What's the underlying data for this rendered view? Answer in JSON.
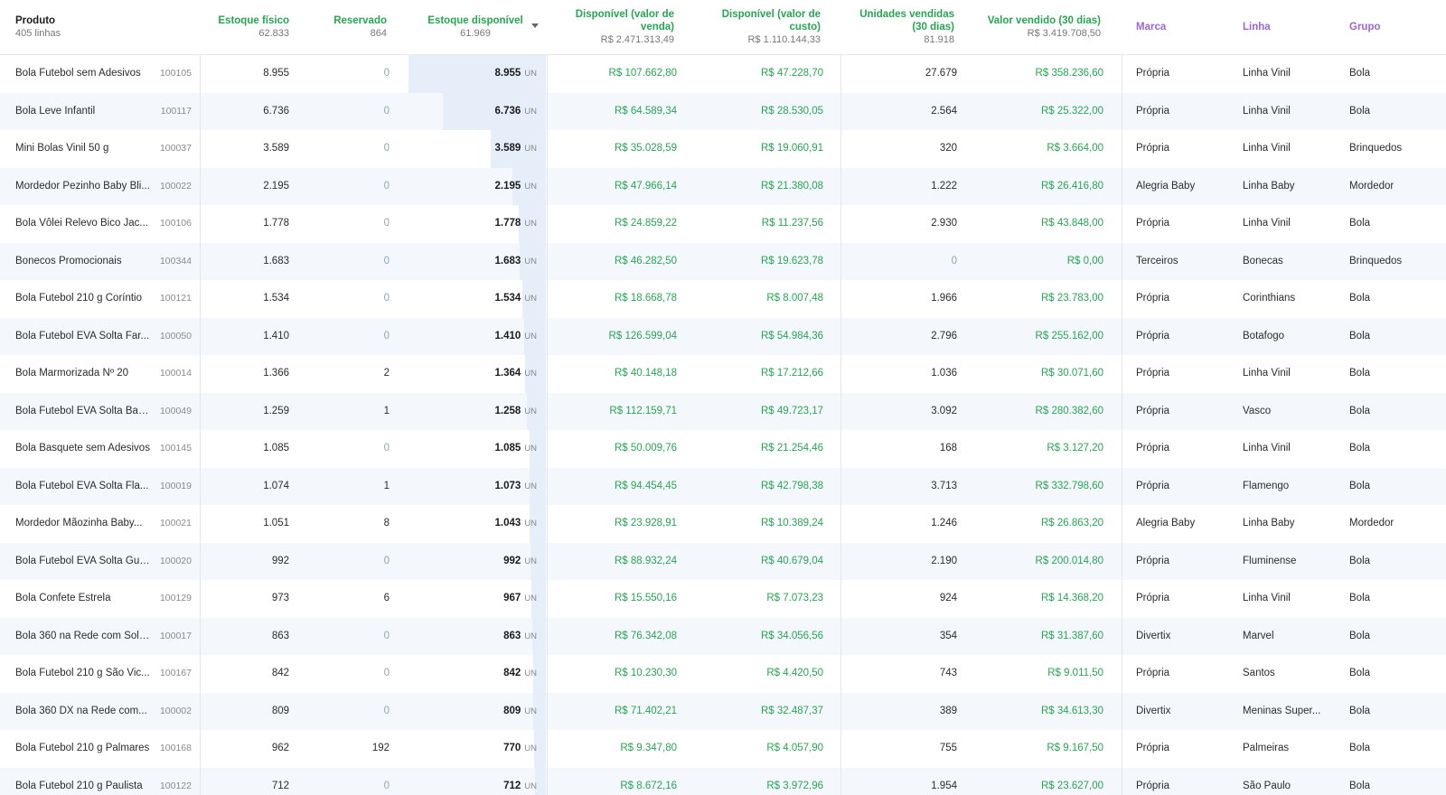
{
  "header": {
    "produto": "Produto",
    "produto_sub": "405 linhas",
    "estoque_fisico": "Estoque físico",
    "estoque_fisico_total": "62.833",
    "reservado": "Reservado",
    "reservado_total": "864",
    "estoque_disponivel": "Estoque disponível",
    "estoque_disponivel_total": "61.969",
    "disp_venda_l1": "Disponível (valor de",
    "disp_venda_l2": "venda)",
    "disp_venda_total": "R$ 2.471.313,49",
    "disp_custo_l1": "Disponível (valor de",
    "disp_custo_l2": "custo)",
    "disp_custo_total": "R$ 1.110.144,33",
    "unid_l1": "Unidades vendidas",
    "unid_l2": "(30 dias)",
    "unid_total": "81.918",
    "valor_vendido": "Valor vendido (30 dias)",
    "valor_vendido_total": "R$ 3.419.708,50",
    "marca": "Marca",
    "linha": "Linha",
    "grupo": "Grupo"
  },
  "unit_label": "UN",
  "stock_scale_max": 8955,
  "colors": {
    "green": "#27a552",
    "purple": "#9b66d9",
    "zero": "#8fa6b8",
    "bar": "#e6eefa"
  },
  "rows": [
    {
      "produto": "Bola Futebol sem Adesivos",
      "codigo": "100105",
      "fisico": "8.955",
      "reservado": "0",
      "disponivel": "8.955",
      "venda": "R$ 107.662,80",
      "custo": "R$ 47.228,70",
      "unidades": "27.679",
      "valor": "R$ 358.236,60",
      "marca": "Própria",
      "linha": "Linha Vinil",
      "grupo": "Bola"
    },
    {
      "produto": "Bola Leve Infantil",
      "codigo": "100117",
      "fisico": "6.736",
      "reservado": "0",
      "disponivel": "6.736",
      "venda": "R$ 64.589,34",
      "custo": "R$ 28.530,05",
      "unidades": "2.564",
      "valor": "R$ 25.322,00",
      "marca": "Própria",
      "linha": "Linha Vinil",
      "grupo": "Bola"
    },
    {
      "produto": "Mini Bolas Vinil 50 g",
      "codigo": "100037",
      "fisico": "3.589",
      "reservado": "0",
      "disponivel": "3.589",
      "venda": "R$ 35.028,59",
      "custo": "R$ 19.060,91",
      "unidades": "320",
      "valor": "R$ 3.664,00",
      "marca": "Própria",
      "linha": "Linha Vinil",
      "grupo": "Brinquedos"
    },
    {
      "produto": "Mordedor Pezinho Baby Bli...",
      "codigo": "100022",
      "fisico": "2.195",
      "reservado": "0",
      "disponivel": "2.195",
      "venda": "R$ 47.966,14",
      "custo": "R$ 21.380,08",
      "unidades": "1.222",
      "valor": "R$ 26.416,80",
      "marca": "Alegria Baby",
      "linha": "Linha Baby",
      "grupo": "Mordedor"
    },
    {
      "produto": "Bola Vôlei Relevo Bico Jac...",
      "codigo": "100106",
      "fisico": "1.778",
      "reservado": "0",
      "disponivel": "1.778",
      "venda": "R$ 24.859,22",
      "custo": "R$ 11.237,56",
      "unidades": "2.930",
      "valor": "R$ 43.848,00",
      "marca": "Própria",
      "linha": "Linha Vinil",
      "grupo": "Bola"
    },
    {
      "produto": "Bonecos Promocionais",
      "codigo": "100344",
      "fisico": "1.683",
      "reservado": "0",
      "disponivel": "1.683",
      "venda": "R$ 46.282,50",
      "custo": "R$ 19.623,78",
      "unidades": "0",
      "valor": "R$ 0,00",
      "marca": "Terceiros",
      "linha": "Bonecas",
      "grupo": "Brinquedos"
    },
    {
      "produto": "Bola Futebol 210 g Coríntio",
      "codigo": "100121",
      "fisico": "1.534",
      "reservado": "0",
      "disponivel": "1.534",
      "venda": "R$ 18.668,78",
      "custo": "R$ 8.007,48",
      "unidades": "1.966",
      "valor": "R$ 23.783,00",
      "marca": "Própria",
      "linha": "Corinthians",
      "grupo": "Bola"
    },
    {
      "produto": "Bola Futebol EVA Solta Far...",
      "codigo": "100050",
      "fisico": "1.410",
      "reservado": "0",
      "disponivel": "1.410",
      "venda": "R$ 126.599,04",
      "custo": "R$ 54.984,36",
      "unidades": "2.796",
      "valor": "R$ 255.162,00",
      "marca": "Própria",
      "linha": "Botafogo",
      "grupo": "Bola"
    },
    {
      "produto": "Bola Marmorizada Nº 20",
      "codigo": "100014",
      "fisico": "1.366",
      "reservado": "2",
      "disponivel": "1.364",
      "venda": "R$ 40.148,18",
      "custo": "R$ 17.212,66",
      "unidades": "1.036",
      "valor": "R$ 30.071,60",
      "marca": "Própria",
      "linha": "Linha Vinil",
      "grupo": "Bola"
    },
    {
      "produto": "Bola Futebol EVA Solta Bas...",
      "codigo": "100049",
      "fisico": "1.259",
      "reservado": "1",
      "disponivel": "1.258",
      "venda": "R$ 112.159,71",
      "custo": "R$ 49.723,17",
      "unidades": "3.092",
      "valor": "R$ 280.382,60",
      "marca": "Própria",
      "linha": "Vasco",
      "grupo": "Bola"
    },
    {
      "produto": "Bola Basquete sem Adesivos",
      "codigo": "100145",
      "fisico": "1.085",
      "reservado": "0",
      "disponivel": "1.085",
      "venda": "R$ 50.009,76",
      "custo": "R$ 21.254,46",
      "unidades": "168",
      "valor": "R$ 3.127,20",
      "marca": "Própria",
      "linha": "Linha Vinil",
      "grupo": "Bola"
    },
    {
      "produto": "Bola Futebol EVA Solta Fla...",
      "codigo": "100019",
      "fisico": "1.074",
      "reservado": "1",
      "disponivel": "1.073",
      "venda": "R$ 94.454,45",
      "custo": "R$ 42.798,38",
      "unidades": "3.713",
      "valor": "R$ 332.798,60",
      "marca": "Própria",
      "linha": "Flamengo",
      "grupo": "Bola"
    },
    {
      "produto": "Mordedor Mãozinha Baby...",
      "codigo": "100021",
      "fisico": "1.051",
      "reservado": "8",
      "disponivel": "1.043",
      "venda": "R$ 23.928,91",
      "custo": "R$ 10.389,24",
      "unidades": "1.246",
      "valor": "R$ 26.863,20",
      "marca": "Alegria Baby",
      "linha": "Linha Baby",
      "grupo": "Mordedor"
    },
    {
      "produto": "Bola Futebol EVA Solta Gua...",
      "codigo": "100020",
      "fisico": "992",
      "reservado": "0",
      "disponivel": "992",
      "venda": "R$ 88.932,24",
      "custo": "R$ 40.679,04",
      "unidades": "2.190",
      "valor": "R$ 200.014,80",
      "marca": "Própria",
      "linha": "Fluminense",
      "grupo": "Bola"
    },
    {
      "produto": "Bola Confete Estrela",
      "codigo": "100129",
      "fisico": "973",
      "reservado": "6",
      "disponivel": "967",
      "venda": "R$ 15.550,16",
      "custo": "R$ 7.073,23",
      "unidades": "924",
      "valor": "R$ 14.368,20",
      "marca": "Própria",
      "linha": "Linha Vinil",
      "grupo": "Bola"
    },
    {
      "produto": "Bola 360 na Rede com Sola...",
      "codigo": "100017",
      "fisico": "863",
      "reservado": "0",
      "disponivel": "863",
      "venda": "R$ 76.342,08",
      "custo": "R$ 34.056,56",
      "unidades": "354",
      "valor": "R$ 31.387,60",
      "marca": "Divertix",
      "linha": "Marvel",
      "grupo": "Bola"
    },
    {
      "produto": "Bola Futebol 210 g São Vic...",
      "codigo": "100167",
      "fisico": "842",
      "reservado": "0",
      "disponivel": "842",
      "venda": "R$ 10.230,30",
      "custo": "R$ 4.420,50",
      "unidades": "743",
      "valor": "R$ 9.011,50",
      "marca": "Própria",
      "linha": "Santos",
      "grupo": "Bola"
    },
    {
      "produto": "Bola 360 DX na Rede com...",
      "codigo": "100002",
      "fisico": "809",
      "reservado": "0",
      "disponivel": "809",
      "venda": "R$ 71.402,21",
      "custo": "R$ 32.487,37",
      "unidades": "389",
      "valor": "R$ 34.613,30",
      "marca": "Divertix",
      "linha": "Meninas Super...",
      "grupo": "Bola"
    },
    {
      "produto": "Bola Futebol 210 g Palmares",
      "codigo": "100168",
      "fisico": "962",
      "reservado": "192",
      "disponivel": "770",
      "venda": "R$ 9.347,80",
      "custo": "R$ 4.057,90",
      "unidades": "755",
      "valor": "R$ 9.167,50",
      "marca": "Própria",
      "linha": "Palmeiras",
      "grupo": "Bola"
    },
    {
      "produto": "Bola Futebol 210 g Paulista",
      "codigo": "100122",
      "fisico": "712",
      "reservado": "0",
      "disponivel": "712",
      "venda": "R$ 8.672,16",
      "custo": "R$ 3.972,96",
      "unidades": "1.954",
      "valor": "R$ 23.627,00",
      "marca": "Própria",
      "linha": "São Paulo",
      "grupo": "Bola"
    }
  ]
}
